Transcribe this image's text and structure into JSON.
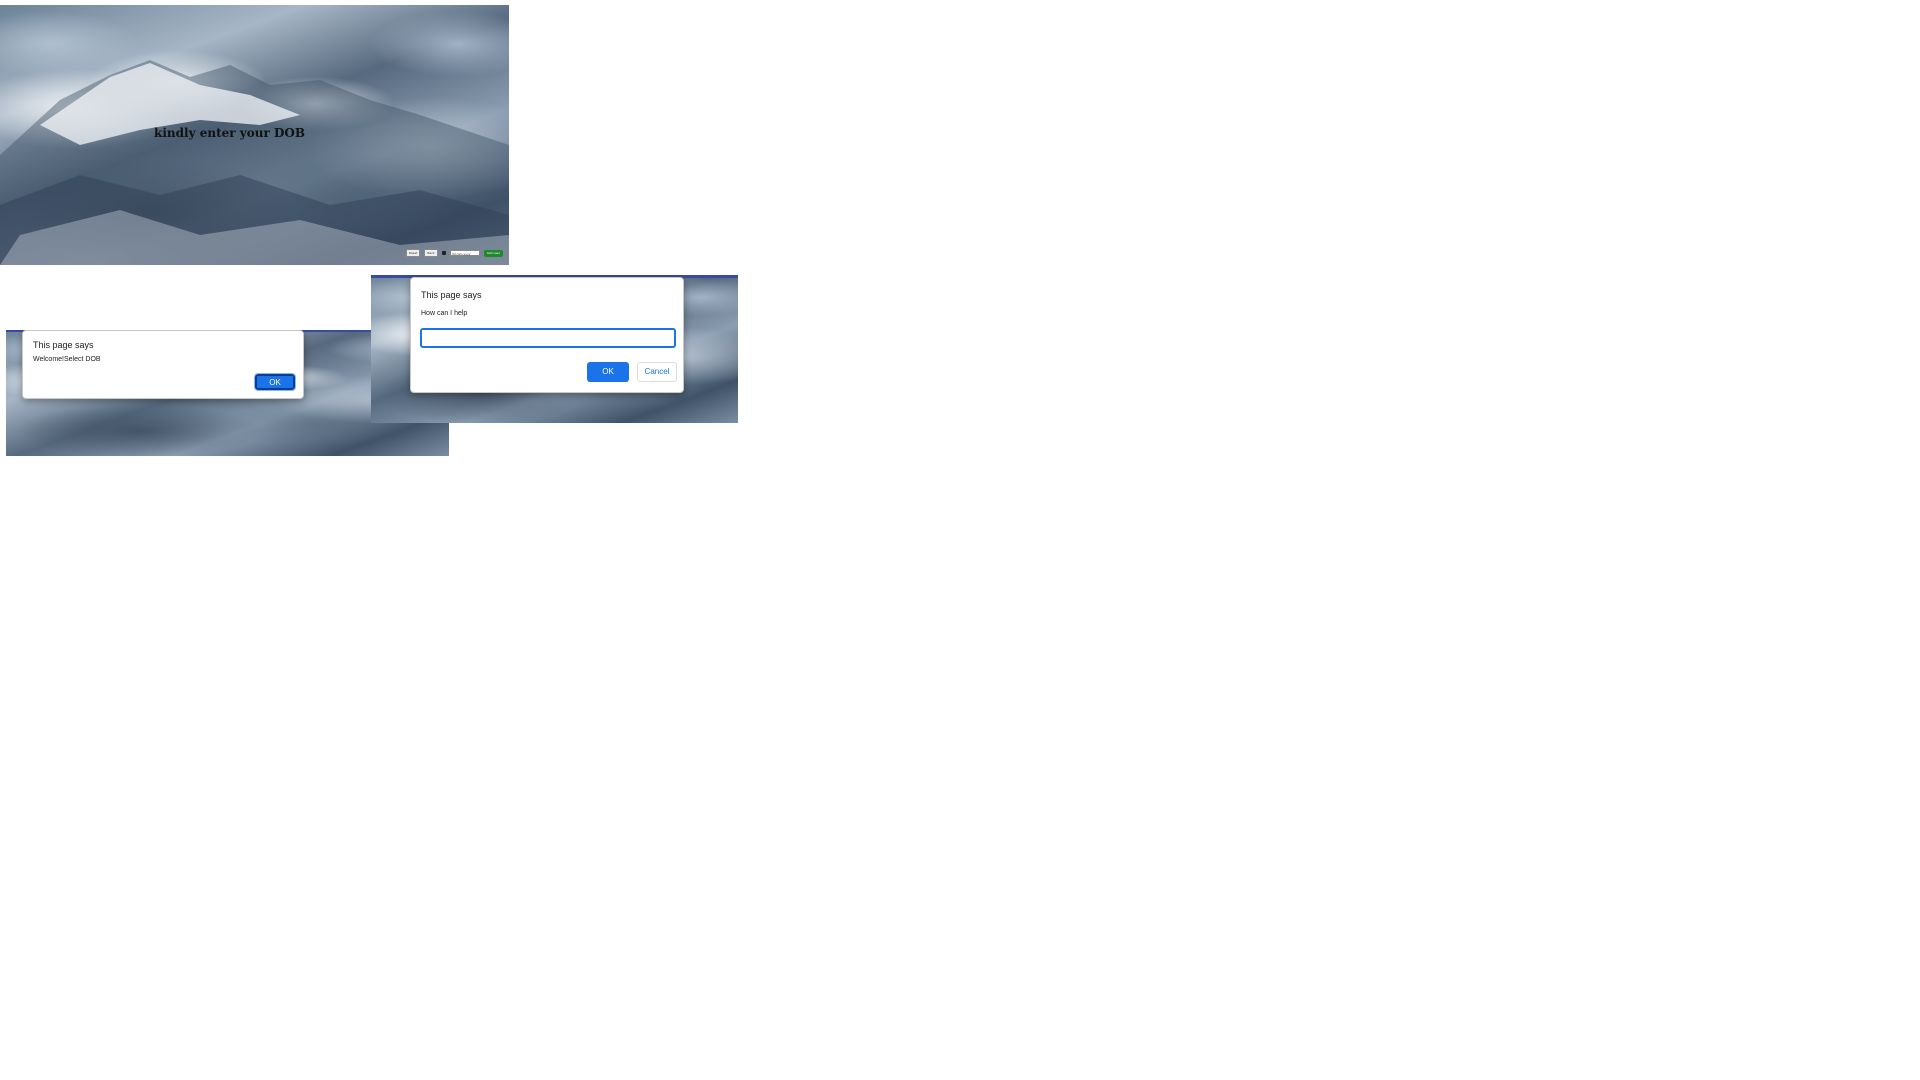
{
  "main_page": {
    "headline": "kindly enter your DOB",
    "controls": {
      "button_1": "Reset",
      "button_2": "Back",
      "date_value": "dd-mm-yyyy",
      "submit_label": "Add user"
    }
  },
  "alert_dialog": {
    "title": "This page says",
    "message": "Welcome!Select DOB",
    "ok_label": "OK"
  },
  "prompt_dialog": {
    "title": "This page says",
    "message": "How can I help",
    "input_value": "",
    "ok_label": "OK",
    "cancel_label": "Cancel"
  },
  "colors": {
    "accent": "#1a73e8",
    "submit_green": "#1f8a2c",
    "top_bar": "#3a4aa0"
  }
}
